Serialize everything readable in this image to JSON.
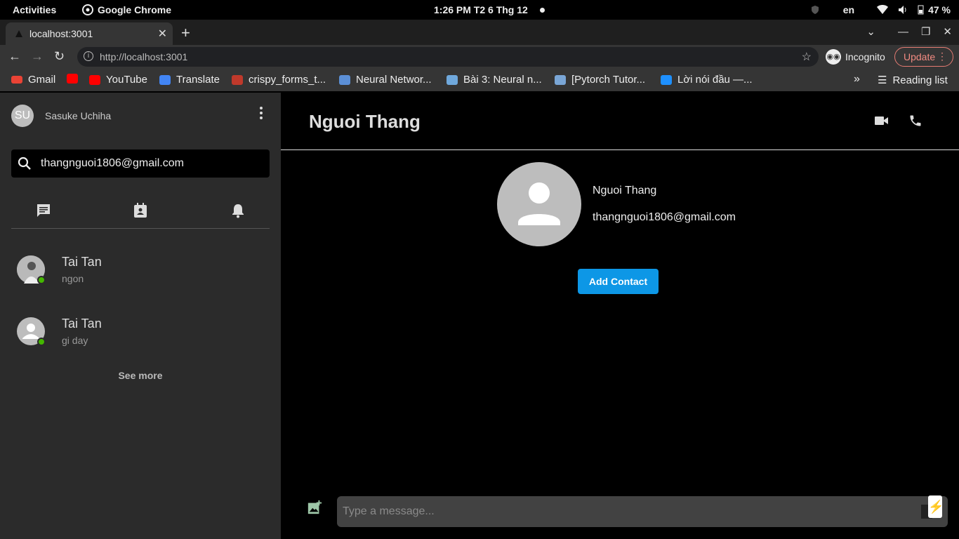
{
  "os": {
    "activities": "Activities",
    "app_name": "Google Chrome",
    "clock": "1:26 PM  T2 6 Thg 12",
    "language": "en",
    "battery": "47 %"
  },
  "browser": {
    "tab_title": "localhost:3001",
    "url": "http://localhost:3001",
    "incognito_label": "Incognito",
    "update_label": "Update",
    "reading_list": "Reading list",
    "bookmarks": [
      {
        "label": "Gmail",
        "color": "#ea4335"
      },
      {
        "label": "YouTube",
        "color": "#ff0000"
      },
      {
        "label": "YouTube",
        "color": "#ff0000"
      },
      {
        "label": "Translate",
        "color": "#4285f4"
      },
      {
        "label": "crispy_forms_t...",
        "color": "#c0392b"
      },
      {
        "label": "Neural Networ...",
        "color": "#5b8fd6"
      },
      {
        "label": "Bài 3: Neural n...",
        "color": "#6fa8dc"
      },
      {
        "label": "[Pytorch Tutor...",
        "color": "#7aa6d6"
      },
      {
        "label": "Lời nói đầu —...",
        "color": "#1e90ff"
      }
    ]
  },
  "sidebar": {
    "user_initials": "SU",
    "user_name": "Sasuke Uchiha",
    "search_value": "thangnguoi1806@gmail.com",
    "conversations": [
      {
        "name": "Tai Tan",
        "last_message": "ngon"
      },
      {
        "name": "Tai Tan",
        "last_message": "gi day"
      }
    ],
    "see_more": "See more"
  },
  "chat": {
    "title": "Nguoi Thang",
    "profile_name": "Nguoi Thang",
    "profile_email": "thangnguoi1806@gmail.com",
    "add_contact": "Add Contact",
    "message_placeholder": "Type a message..."
  },
  "colors": {
    "accent": "#0d97e6",
    "online": "#44b700",
    "sidebar_bg": "#2b2b2b"
  }
}
